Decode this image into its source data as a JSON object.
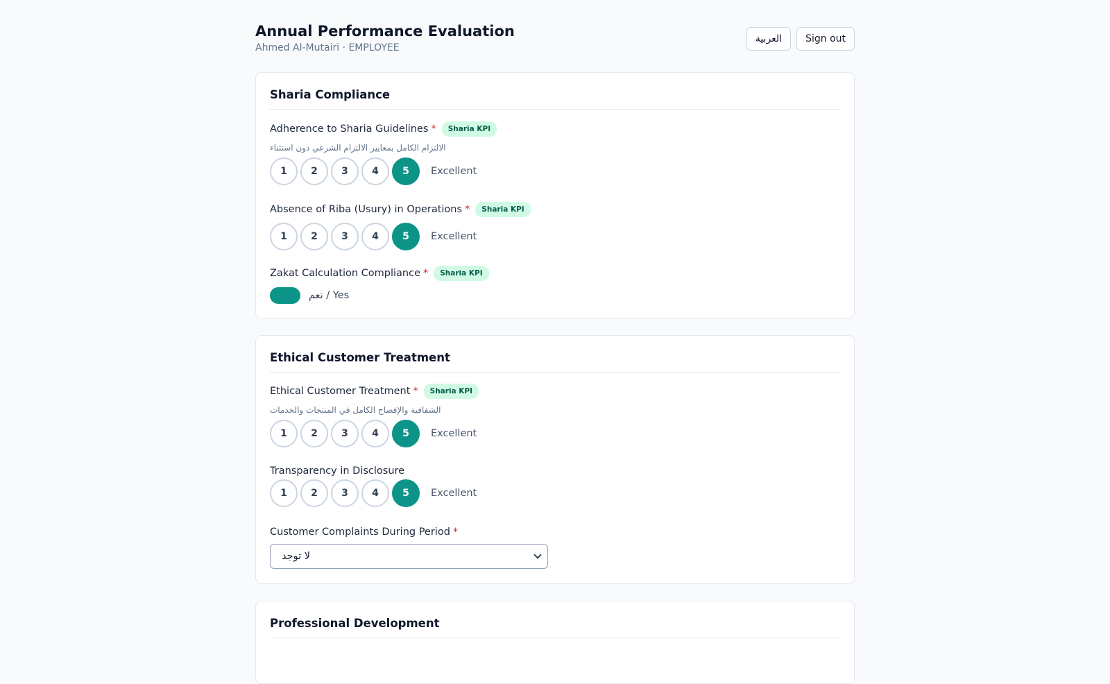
{
  "header": {
    "title": "Annual Performance Evaluation",
    "subtitle": "Ahmed Al-Mutairi · EMPLOYEE",
    "lang_button": "العربية",
    "signout_button": "Sign out"
  },
  "colors": {
    "accent": "#0d9488",
    "badge_bg": "#d1fae5",
    "required": "#dc2626"
  },
  "rating_labels": [
    "1",
    "2",
    "3",
    "4",
    "5"
  ],
  "sections": [
    {
      "title": "Sharia Compliance",
      "questions": [
        {
          "label": "Adherence to Sharia Guidelines",
          "required": "*",
          "badge": "Sharia KPI",
          "hint": "الالتزام الكامل بمعايير الالتزام الشرعي دون استثناء",
          "selected": 5,
          "rating_text": "Excellent"
        },
        {
          "label": "Absence of Riba (Usury) in Operations",
          "required": "*",
          "badge": "Sharia KPI",
          "selected": 5,
          "rating_text": "Excellent"
        },
        {
          "label": "Zakat Calculation Compliance",
          "required": "*",
          "badge": "Sharia KPI",
          "toggle_on": true,
          "toggle_label": "نعم / Yes"
        }
      ]
    },
    {
      "title": "Ethical Customer Treatment",
      "questions": [
        {
          "label": "Ethical Customer Treatment",
          "required": "*",
          "badge": "Sharia KPI",
          "hint": "الشفافية والإفصاح الكامل في المنتجات والخدمات",
          "selected": 5,
          "rating_text": "Excellent"
        },
        {
          "label": "Transparency in Disclosure",
          "selected": 5,
          "rating_text": "Excellent"
        },
        {
          "label": "Customer Complaints During Period",
          "required": "*",
          "select_value": "لا توجد"
        }
      ]
    },
    {
      "title": "Professional Development"
    }
  ]
}
